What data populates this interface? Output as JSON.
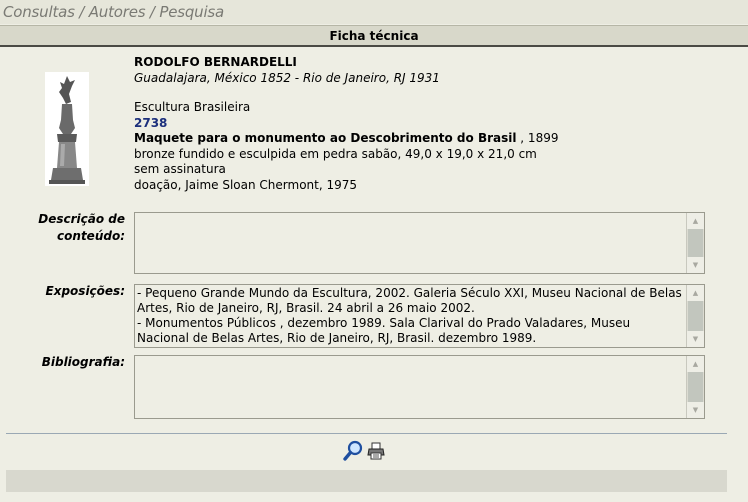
{
  "breadcrumb": "Consultas / Autores / Pesquisa",
  "section_title": "Ficha técnica",
  "artist": {
    "name": "RODOLFO BERNARDELLI",
    "dates": "Guadalajara, México 1852 - Rio de Janeiro, RJ 1931"
  },
  "work": {
    "collection": "Escultura Brasileira",
    "number": "2738",
    "title": "Maquete para o monumento ao Descobrimento do Brasil",
    "year": " , 1899",
    "technique": "bronze fundido e esculpida em pedra sabão, 49,0 x 19,0 x 21,0 cm",
    "signature": "sem assinatura",
    "acquisition": "doação, Jaime Sloan Chermont, 1975"
  },
  "fields": {
    "descricao_label": "Descrição de conteúdo:",
    "descricao_value": "",
    "exposicoes_label": "Exposições:",
    "exposicoes_value": "- Pequeno Grande Mundo da Escultura, 2002. Galeria Século XXI, Museu Nacional de Belas Artes, Rio de Janeiro, RJ, Brasil. 24 abril a 26 maio 2002.\n- Monumentos Públicos , dezembro 1989. Sala Clarival do Prado Valadares, Museu Nacional de Belas Artes, Rio de Janeiro, RJ, Brasil. dezembro 1989.",
    "bibliografia_label": "Bibliografia:",
    "bibliografia_value": ""
  },
  "icons": {
    "zoom": "magnifier-icon",
    "print": "printer-icon"
  },
  "colors": {
    "number": "#1c2f7c",
    "background": "#eeeee4",
    "header": "#d8d8ca"
  }
}
